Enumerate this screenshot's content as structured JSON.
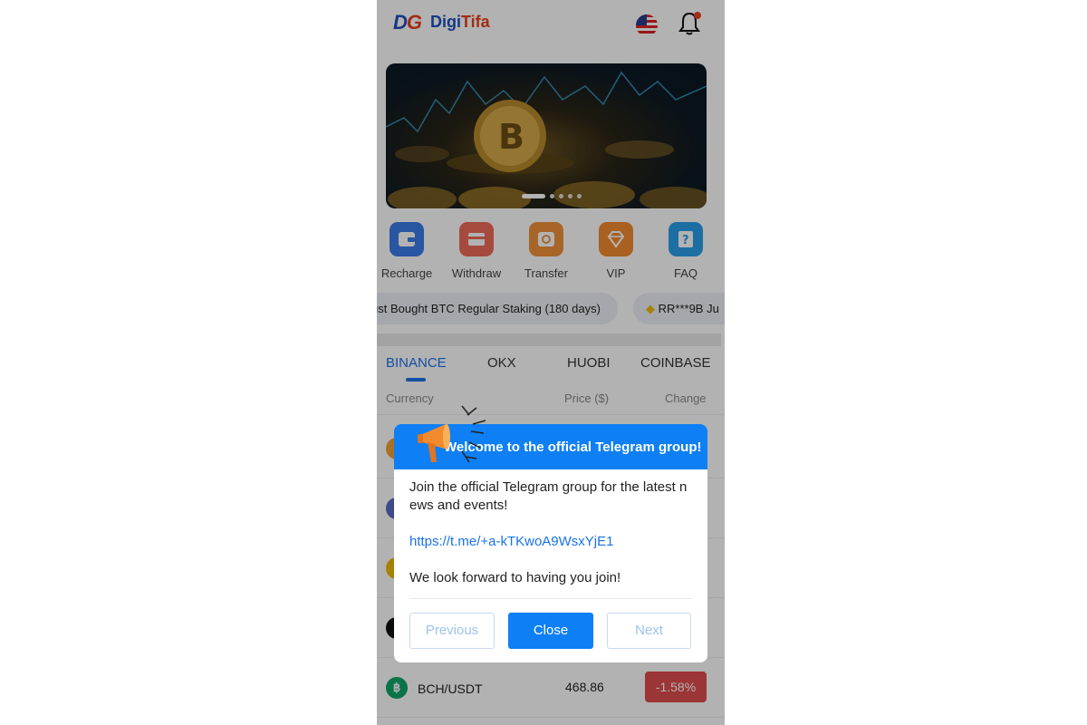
{
  "header": {
    "logo_mark_1": "D",
    "logo_mark_2": "G",
    "logo_text_1": "Digi",
    "logo_text_2": "Tifa",
    "icons": [
      "us-flag-icon",
      "bell-icon"
    ],
    "notification_dot_color": "#e8411e"
  },
  "banner": {
    "slide_count": 5,
    "active_slide": 1
  },
  "quick_actions": [
    {
      "label": "Recharge",
      "color": "#3b7be8",
      "icon": "wallet-icon"
    },
    {
      "label": "Withdraw",
      "color": "#ee6a5a",
      "icon": "card-icon"
    },
    {
      "label": "Transfer",
      "color": "#f0933a",
      "icon": "transfer-icon"
    },
    {
      "label": "VIP",
      "color": "#f28a2e",
      "icon": "diamond-icon"
    },
    {
      "label": "FAQ",
      "color": "#2aa0ea",
      "icon": "question-icon"
    }
  ],
  "ticker": [
    {
      "text": "ust Bought BTC Regular Staking (180 days)"
    },
    {
      "text": "RR***9B Ju"
    }
  ],
  "exchange_tabs": [
    "BINANCE",
    "OKX",
    "HUOBI",
    "COINBASE"
  ],
  "active_tab": "BINANCE",
  "table": {
    "headers": {
      "currency": "Currency",
      "price": "Price ($)",
      "change": "Change"
    },
    "rows": [
      {
        "coin_color": "#f3a33a"
      },
      {
        "coin_color": "#5c6bc0"
      },
      {
        "coin_color": "#f0b90b"
      },
      {
        "coin_color": "#111111"
      },
      {
        "pair": "BCH/USDT",
        "price": "468.86",
        "change": "-1.58%",
        "coin_color": "#0fa56a"
      }
    ]
  },
  "modal": {
    "title": "Welcome to the official Telegram group!",
    "message": "Join the official Telegram group for the latest news and events!",
    "link": "https://t.me/+a-kTKwoA9WsxYjE1",
    "closing": "We look forward to having you join!",
    "buttons": {
      "previous": "Previous",
      "close": "Close",
      "next": "Next"
    },
    "accent_color": "#0e7ff4"
  }
}
